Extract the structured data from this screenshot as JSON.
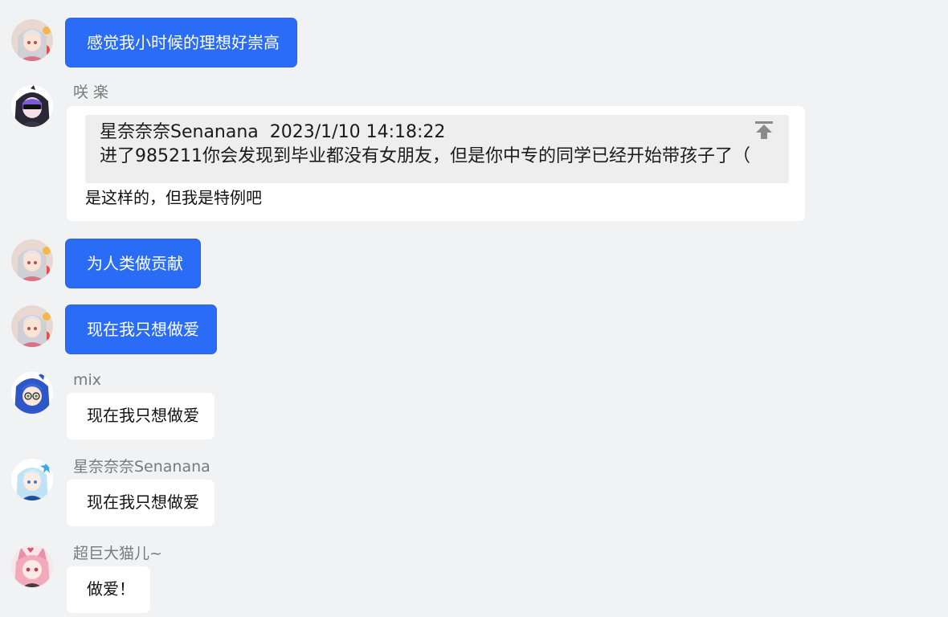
{
  "messages": [
    {
      "sender": "",
      "text": "感觉我小时候的理想好崇高",
      "avatar_icon": "anime-girl-silver-hair-avatar-icon"
    },
    {
      "sender": "咲 楽",
      "avatar_icon": "anime-dark-hood-sunglasses-avatar-icon",
      "quote": {
        "author": "星奈奈奈Senanana",
        "time": "2023/1/10 14:18:22",
        "text": "进了985211你会发现到毕业都没有女朋友，但是你中专的同学已经开始带孩子了（",
        "jump_icon": "jump-to-top-icon"
      },
      "text": "是这样的，但我是特例吧"
    },
    {
      "sender": "",
      "text": "为人类做贡献",
      "avatar_icon": "anime-girl-silver-hair-avatar-icon"
    },
    {
      "sender": "",
      "text": "现在我只想做爱",
      "avatar_icon": "anime-girl-silver-hair-avatar-icon"
    },
    {
      "sender": "mix",
      "text": "现在我只想做爱",
      "avatar_icon": "anime-blue-hair-glasses-avatar-icon"
    },
    {
      "sender": "星奈奈奈Senanana",
      "text": "现在我只想做爱",
      "avatar_icon": "anime-light-blue-hair-avatar-icon"
    },
    {
      "sender": "超巨大猫儿~",
      "text": "做爱！",
      "avatar_icon": "anime-pink-hair-cat-avatar-icon"
    }
  ],
  "colors": {
    "self_bubble": "#2b6cf7",
    "other_bubble": "#ffffff",
    "background": "#f1f2f3",
    "quote_background": "#eeeeee",
    "nickname": "#7a7a7a"
  }
}
